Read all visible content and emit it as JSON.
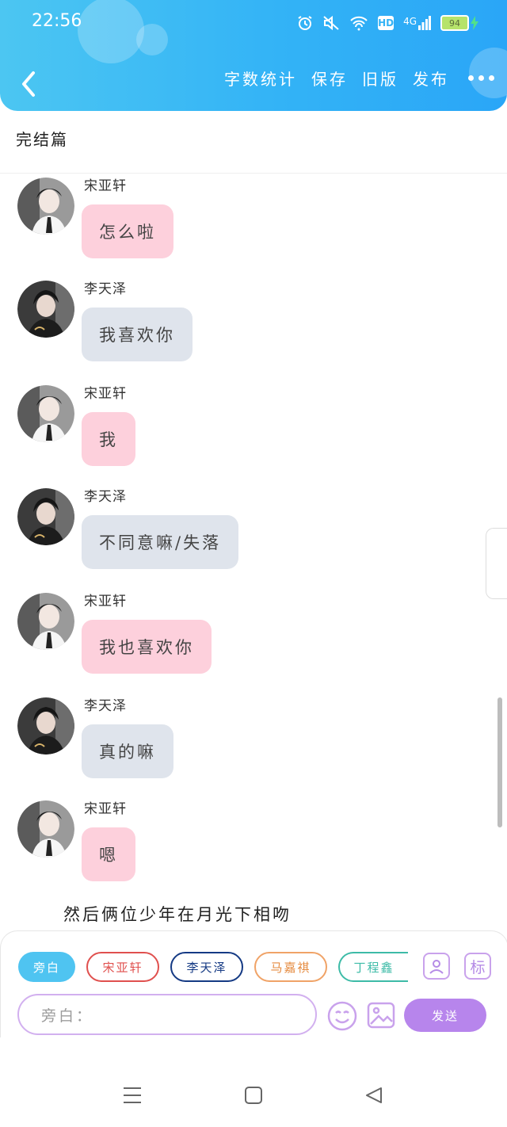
{
  "status_bar": {
    "time": "22:56",
    "network": "4G",
    "hd": "HD",
    "battery": "94"
  },
  "header": {
    "actions": [
      "字数统计",
      "保存",
      "旧版",
      "发布"
    ],
    "colors": {
      "gradient_start": "#4cc6f2",
      "gradient_end": "#2aa6f7"
    }
  },
  "chapter_title": "完结篇",
  "messages": [
    {
      "sender": "宋亚轩",
      "text": "怎么啦",
      "style": "pink",
      "avatar": "avatar-songyaxuan"
    },
    {
      "sender": "李天泽",
      "text": "我喜欢你",
      "style": "gray",
      "avatar": "avatar-litianze"
    },
    {
      "sender": "宋亚轩",
      "text": "我",
      "style": "pink",
      "avatar": "avatar-songyaxuan"
    },
    {
      "sender": "李天泽",
      "text": "不同意嘛/失落",
      "style": "gray",
      "avatar": "avatar-litianze"
    },
    {
      "sender": "宋亚轩",
      "text": "我也喜欢你",
      "style": "pink",
      "avatar": "avatar-songyaxuan"
    },
    {
      "sender": "李天泽",
      "text": "真的嘛",
      "style": "gray",
      "avatar": "avatar-litianze"
    },
    {
      "sender": "宋亚轩",
      "text": "嗯",
      "style": "pink",
      "avatar": "avatar-songyaxuan"
    }
  ],
  "narration": "然后俩位少年在月光下相吻",
  "compose": {
    "chips": [
      "旁白",
      "宋亚轩",
      "李天泽",
      "马嘉祺",
      "丁程鑫"
    ],
    "tag_button": "标",
    "input_placeholder": "旁白：",
    "send_label": "发送",
    "colors": {
      "accent": "#b785ec",
      "aside": "#4fc4f1",
      "song": "#e0504e",
      "li": "#153a84",
      "ma": "#f0a367",
      "ding": "#3dbba7"
    }
  }
}
